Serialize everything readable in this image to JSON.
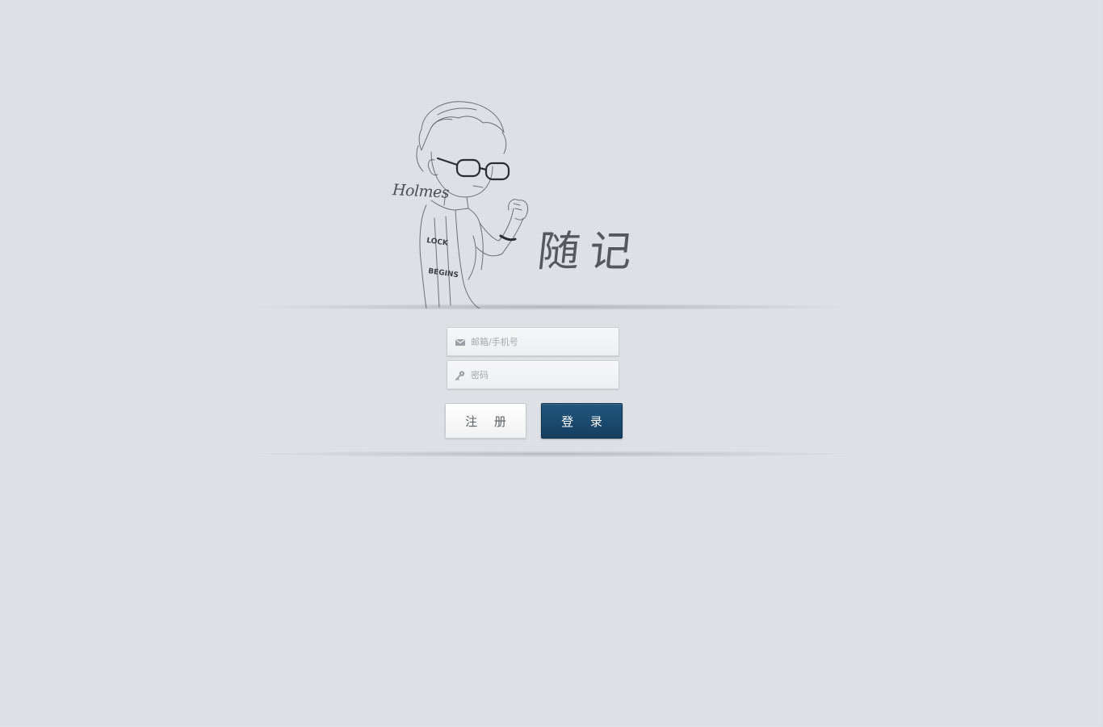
{
  "brand": {
    "title": "随记",
    "signature": "Holmes",
    "shirt_text_line1": "LOCK",
    "shirt_text_line2": "BEGINS"
  },
  "login_form": {
    "email_placeholder": "邮箱/手机号",
    "password_placeholder": "密码",
    "register_label": "注 册",
    "login_label": "登 录"
  },
  "icons": {
    "email": "envelope-icon",
    "password": "key-icon"
  },
  "colors": {
    "background": "#dde1e6",
    "login_button": "#1b4b72",
    "register_button": "#f7f8f9",
    "title_text": "#55585c"
  }
}
